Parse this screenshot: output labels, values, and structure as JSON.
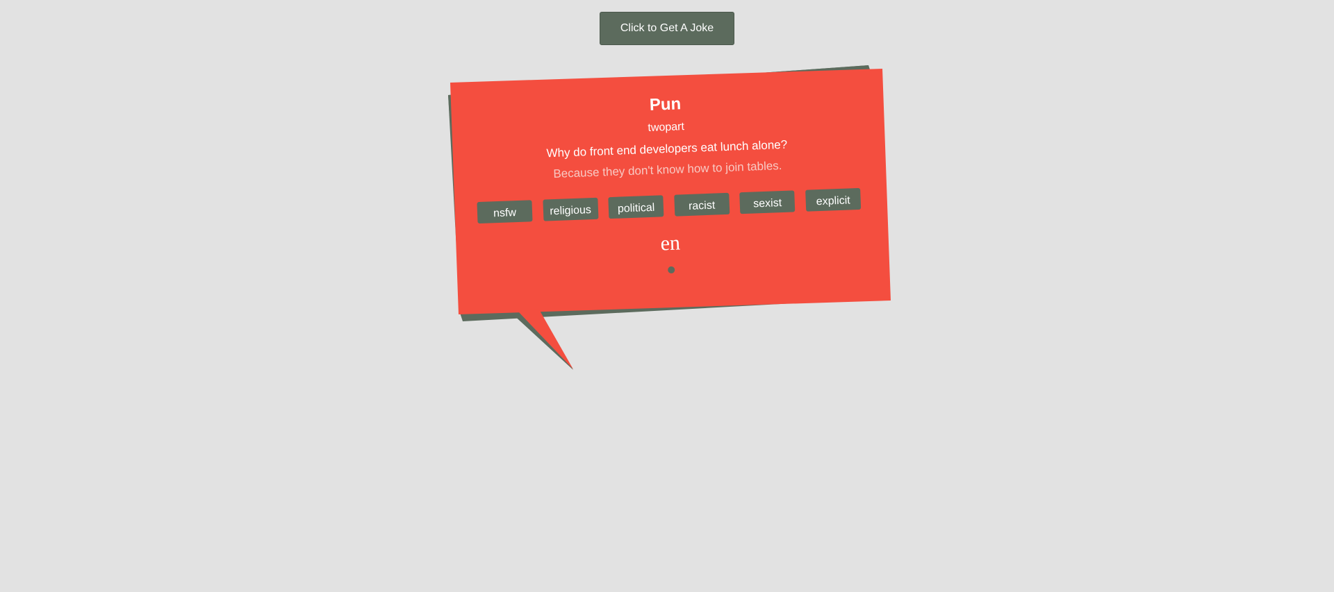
{
  "header": {
    "joke_button_label": "Click to Get A Joke"
  },
  "joke": {
    "category": "Pun",
    "type": "twopart",
    "setup": "Why do front end developers eat lunch alone?",
    "delivery": "Because they don't know how to join tables.",
    "flags": [
      {
        "label": "nsfw"
      },
      {
        "label": "religious"
      },
      {
        "label": "political"
      },
      {
        "label": "racist"
      },
      {
        "label": "sexist"
      },
      {
        "label": "explicit"
      }
    ],
    "lang": "en"
  },
  "colors": {
    "background": "#e2e2e2",
    "bubble": "#f44e3f",
    "bubble_shadow": "#5c6b5d",
    "button": "#5c6b5d",
    "text": "#ffffff"
  }
}
